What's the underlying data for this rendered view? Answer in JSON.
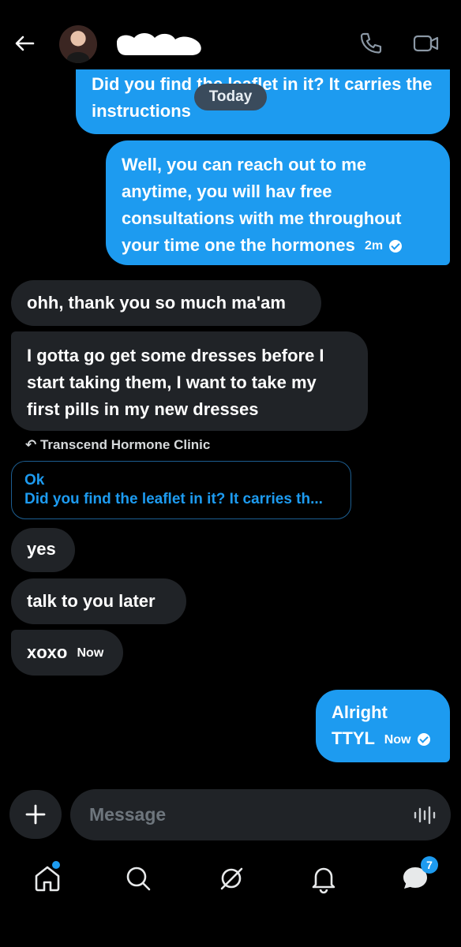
{
  "header": {
    "back_icon": "arrow-left-icon",
    "call_icon": "phone-icon",
    "video_icon": "video-camera-icon"
  },
  "date_separator": "Today",
  "messages": [
    {
      "direction": "outgoing",
      "text": "Did you find the leaflet in it? It carries the instructions"
    },
    {
      "direction": "outgoing",
      "text": "Well, you can reach out to me anytime, you will hav free consultations with me throughout your time one the hormones",
      "time": "2m",
      "status": "read"
    },
    {
      "direction": "incoming",
      "text": "ohh, thank you so much ma'am"
    },
    {
      "direction": "incoming",
      "text": "I gotta go get some dresses before I start taking them, I want to take my first pills in my new dresses"
    },
    {
      "direction": "incoming",
      "text": "yes"
    },
    {
      "direction": "incoming",
      "text": "talk to you later"
    },
    {
      "direction": "incoming",
      "text": "xoxo",
      "time": "Now"
    },
    {
      "direction": "outgoing",
      "text": "Alright TTYL",
      "time": "Now",
      "status": "read"
    }
  ],
  "reply": {
    "label": "Transcend Hormone Clinic",
    "text": "Ok",
    "quoted": "Did you find the leaflet in it? It carries th..."
  },
  "composer": {
    "placeholder": "Message",
    "add_icon": "plus-icon",
    "voice_icon": "voice-wave-icon"
  },
  "nav": {
    "messages_badge": "7"
  },
  "colors": {
    "accent": "#1d9bf0",
    "incoming_bubble": "#202327",
    "background": "#000000"
  }
}
